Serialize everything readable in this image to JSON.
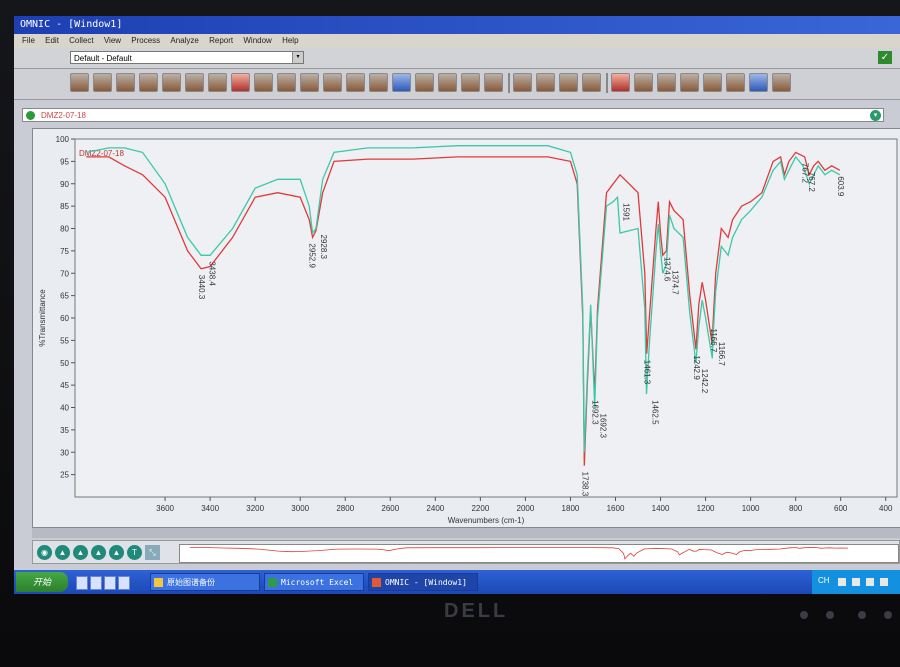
{
  "window": {
    "title": "OMNIC - [Window1]"
  },
  "menu": [
    "File",
    "Edit",
    "Collect",
    "View",
    "Process",
    "Analyze",
    "Report",
    "Window",
    "Help"
  ],
  "toolbar": {
    "combo_value": "Default - Default",
    "combo_arrow": "▾"
  },
  "toolbar_icons": [
    "display-icon",
    "overlay-icon",
    "full-scale-icon",
    "common-scale-icon",
    "stack-icon",
    "offset-icon",
    "clear-icon",
    "find-peaks-icon",
    "baseline-icon",
    "library-icon",
    "peak-label-icon",
    "annotate-icon",
    "zoom-icon",
    "restore-icon",
    "print-icon",
    "copy-icon",
    "spectral-search-icon",
    "zoom-in-icon",
    "zoom-out-icon",
    "qc-icon",
    "match-icon",
    "arrow-icon",
    "region-icon",
    "cut-icon",
    "subtract-icon",
    "add-icon",
    "save-icon",
    "layout-icon",
    "help-icon",
    "tile-icon",
    "cascade-icon"
  ],
  "spectrum_bar": {
    "label": "DMZ2-07-18"
  },
  "chart_data": {
    "type": "line",
    "title": "",
    "xlabel": "Wavenumbers (cm-1)",
    "ylabel": "%Transmittance",
    "xlim": [
      4000,
      350
    ],
    "ylim": [
      20,
      100
    ],
    "x_ticks": [
      3600,
      3400,
      3200,
      3000,
      2800,
      2600,
      2400,
      2200,
      2000,
      1800,
      1600,
      1400,
      1200,
      1000,
      800,
      600,
      400
    ],
    "y_ticks": [
      25,
      30,
      35,
      40,
      45,
      50,
      55,
      60,
      65,
      70,
      75,
      80,
      85,
      90,
      95,
      100
    ],
    "in_plot_label": "DMZ2-07-18",
    "series": [
      {
        "color": "#e03a3a",
        "x": [
          3950,
          3850,
          3780,
          3700,
          3600,
          3550,
          3500,
          3440,
          3400,
          3300,
          3200,
          3100,
          3000,
          2960,
          2945,
          2930,
          2900,
          2850,
          2700,
          2500,
          2300,
          2100,
          1900,
          1800,
          1770,
          1745,
          1738.3,
          1725,
          1710,
          1692.3,
          1680,
          1640,
          1610,
          1580,
          1500,
          1470,
          1461.3,
          1450,
          1420,
          1410,
          1400,
          1390,
          1374,
          1360,
          1340,
          1300,
          1270,
          1242.9,
          1230,
          1215,
          1200,
          1170,
          1166.7,
          1155,
          1130,
          1100,
          1080,
          1040,
          1000,
          950,
          900,
          867,
          850,
          830,
          800,
          760,
          740,
          720,
          700,
          670,
          640,
          603.9
        ],
        "y": [
          96,
          96,
          94,
          92,
          87,
          81,
          75,
          71,
          71.5,
          78,
          87,
          88,
          87,
          82,
          78,
          79.5,
          88,
          95,
          95.5,
          95.5,
          96,
          96,
          96,
          95,
          90,
          60,
          27,
          45,
          62,
          43,
          62,
          88,
          90,
          92,
          88,
          70,
          52,
          60,
          80,
          86,
          79,
          74,
          75,
          86,
          84,
          82,
          65,
          53,
          63,
          68,
          64,
          54,
          59,
          70,
          80,
          78,
          82,
          85,
          86,
          88,
          95,
          96,
          92,
          95,
          97,
          96,
          92,
          94,
          95,
          93,
          94,
          93
        ]
      },
      {
        "color": "#3cc8a8",
        "x": [
          3950,
          3850,
          3780,
          3700,
          3600,
          3550,
          3500,
          3440,
          3400,
          3300,
          3200,
          3100,
          3000,
          2960,
          2945,
          2930,
          2900,
          2850,
          2700,
          2500,
          2300,
          2100,
          1900,
          1800,
          1770,
          1745,
          1738.3,
          1725,
          1710,
          1692.3,
          1680,
          1640,
          1610,
          1591,
          1580,
          1500,
          1470,
          1462.5,
          1450,
          1420,
          1410,
          1400,
          1390,
          1374,
          1360,
          1340,
          1300,
          1270,
          1242.9,
          1230,
          1215,
          1200,
          1170,
          1166.7,
          1155,
          1130,
          1100,
          1080,
          1040,
          1000,
          950,
          900,
          867,
          850,
          830,
          800,
          767.2,
          740,
          720,
          700,
          670,
          640,
          603.9
        ],
        "y": [
          97,
          98,
          98,
          97,
          90,
          84,
          78,
          74,
          74,
          80,
          89,
          91,
          91,
          85,
          79,
          80,
          91,
          97,
          98,
          98,
          98.5,
          98.5,
          98.5,
          97,
          92,
          62,
          30,
          47,
          63,
          40,
          60,
          85,
          86,
          87,
          79,
          80,
          62,
          43,
          54,
          75,
          81,
          75,
          70,
          72,
          83,
          80,
          78,
          61,
          50,
          58,
          64,
          60,
          51,
          56,
          66,
          76,
          74,
          78,
          82,
          84,
          87,
          93,
          95,
          91,
          93,
          96,
          94,
          90,
          92,
          94,
          92,
          93,
          92
        ]
      }
    ],
    "peak_labels": [
      {
        "x": 3440,
        "text": "3440.3",
        "series": 0
      },
      {
        "x": 3430,
        "text": "3438.4",
        "series": 1
      },
      {
        "x": 2950,
        "text": "2952.9",
        "series": 0
      },
      {
        "x": 2935,
        "text": "2928.3",
        "series": 1
      },
      {
        "x": 1738.3,
        "text": "1738.3",
        "series": 0
      },
      {
        "x": 1692.3,
        "text": "1692.3",
        "series": 0
      },
      {
        "x": 1692.3,
        "text": "1692.3",
        "series": 1
      },
      {
        "x": 1591,
        "text": "1591",
        "series": 1
      },
      {
        "x": 1462.5,
        "text": "1462.5",
        "series": 1
      },
      {
        "x": 1461.3,
        "text": "1461.3",
        "series": 0
      },
      {
        "x": 1374,
        "text": "1374.6",
        "series": 0
      },
      {
        "x": 1374,
        "text": "1374.7",
        "series": 1
      },
      {
        "x": 1242.9,
        "text": "1242.9",
        "series": 0
      },
      {
        "x": 1242.2,
        "text": "1242.2",
        "series": 1
      },
      {
        "x": 1166.7,
        "text": "1166.7",
        "series": 0
      },
      {
        "x": 1166.7,
        "text": "1166.7",
        "series": 1
      },
      {
        "x": 767.2,
        "text": "767.2",
        "series": 1
      },
      {
        "x": 760,
        "text": "767.2",
        "series": 0
      },
      {
        "x": 603.9,
        "text": "603.9",
        "series": 0
      }
    ]
  },
  "taskbar": {
    "start": "开始",
    "tasks": [
      {
        "label": "原始图谱备份"
      },
      {
        "label": "Microsoft Excel"
      },
      {
        "label": "OMNIC - [Window1]"
      }
    ],
    "clock": "CH"
  },
  "monitor": {
    "brand": "DELL"
  }
}
